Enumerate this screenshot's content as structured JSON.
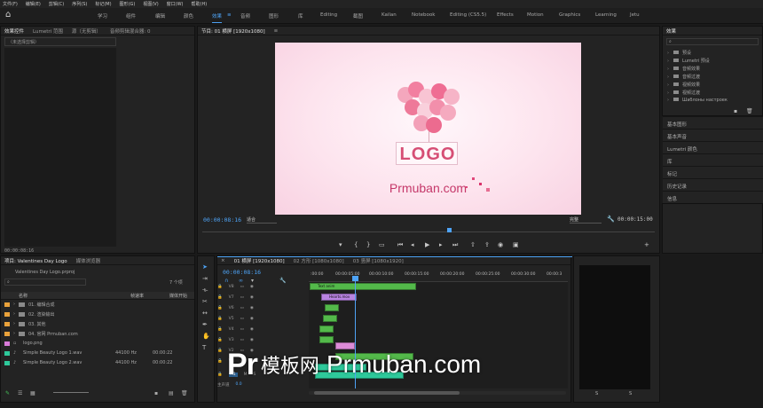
{
  "menu": [
    "文件(F)",
    "编辑(E)",
    "剪辑(C)",
    "序列(S)",
    "标记(M)",
    "图形(G)",
    "视图(V)",
    "窗口(W)",
    "帮助(H)"
  ],
  "workspaces": [
    "学习",
    "组件",
    "编辑",
    "颜色",
    "效果",
    "音频",
    "图形",
    "库",
    "Editing",
    "截图",
    "Kailan",
    "Notebook",
    "Editing (CS5.5)",
    "Effects",
    "Motion",
    "Graphics",
    "Learning",
    "Jetu"
  ],
  "workspace_active_index": 4,
  "source_panel": {
    "tabs": [
      "效果控件",
      "Lumetri 范围",
      "源（无剪辑）",
      "音频剪辑混合器: 0"
    ],
    "placeholder": "（未选择剪辑）",
    "timecode": "00:00:08:16"
  },
  "program": {
    "tab": "节目: 01 横屏 [1920x1080]",
    "timecode": "00:00:08:16",
    "fit": "适合",
    "quality": "完整",
    "duration": "00:00:15:00"
  },
  "preview": {
    "logo": "LOGO",
    "url": "Prmuban.com"
  },
  "project": {
    "tabs": [
      "项目: Valentines Day Logo",
      "媒体浏览器"
    ],
    "file": "Valentines Day Logo.prproj",
    "item_count": "7 个项",
    "col_name": "名称",
    "col_rate": "帧速率",
    "col_start": "媒体开始",
    "items": [
      {
        "name": "01. 编辑合成",
        "rate": "",
        "start": "",
        "color": "#e9a23b",
        "kind": "folder"
      },
      {
        "name": "02. 渲染输出",
        "rate": "",
        "start": "",
        "color": "#e9a23b",
        "kind": "folder"
      },
      {
        "name": "03. 其他",
        "rate": "",
        "start": "",
        "color": "#e9a23b",
        "kind": "folder"
      },
      {
        "name": "04. 官网 Prmuban.com",
        "rate": "",
        "start": "",
        "color": "#e9a23b",
        "kind": "folder"
      },
      {
        "name": "logo.png",
        "rate": "",
        "start": "",
        "color": "#d97ad9",
        "kind": "file"
      },
      {
        "name": "Simple Beauty Logo 1.wav",
        "rate": "44100 Hz",
        "start": "00:00:22",
        "color": "#2ec99b",
        "kind": "file"
      },
      {
        "name": "Simple Beauty Logo 2.wav",
        "rate": "44100 Hz",
        "start": "00:00:22",
        "color": "#2ec99b",
        "kind": "file"
      }
    ]
  },
  "timeline": {
    "tabs": [
      "01 横屏 [1920x1080]",
      "02 方形 [1080x1080]",
      "03 竖屏 [1080x1920]"
    ],
    "timecode": "00:00:08:16",
    "ruler": [
      ":00:00",
      "00:00:05:00",
      "00:00:10:00",
      "00:00:15:00",
      "00:00:20:00",
      "00:00:25:00",
      "00:00:30:00",
      "00:00:3"
    ],
    "video_tracks": [
      "V8",
      "V7",
      "V6",
      "V5",
      "V4",
      "V3",
      "V2",
      "V1"
    ],
    "audio_tracks": [
      "A1"
    ],
    "master": "主声道",
    "master_val": "0.0",
    "clips": [
      "Text anim",
      "Hearts.mov"
    ]
  },
  "effects": {
    "title": "效果",
    "items": [
      "预设",
      "Lumetri 预设",
      "音频效果",
      "音频过渡",
      "视频效果",
      "视频过渡",
      "Шаблоны настроек"
    ]
  },
  "right_panels": [
    "基本图形",
    "基本声音",
    "Lumetri 颜色",
    "库",
    "标记",
    "历史记录",
    "信息"
  ],
  "vu": {
    "left_label": "S",
    "right_label": "S"
  },
  "watermark": {
    "pr": "Pr",
    "cn": "模板网",
    "url": "Prmuban.com"
  },
  "colors": {
    "accent": "#4ea3f5",
    "panel": "#232323",
    "green_clip": "#53b94a",
    "purple_clip": "#b883e0",
    "pink": "#d64e75"
  }
}
